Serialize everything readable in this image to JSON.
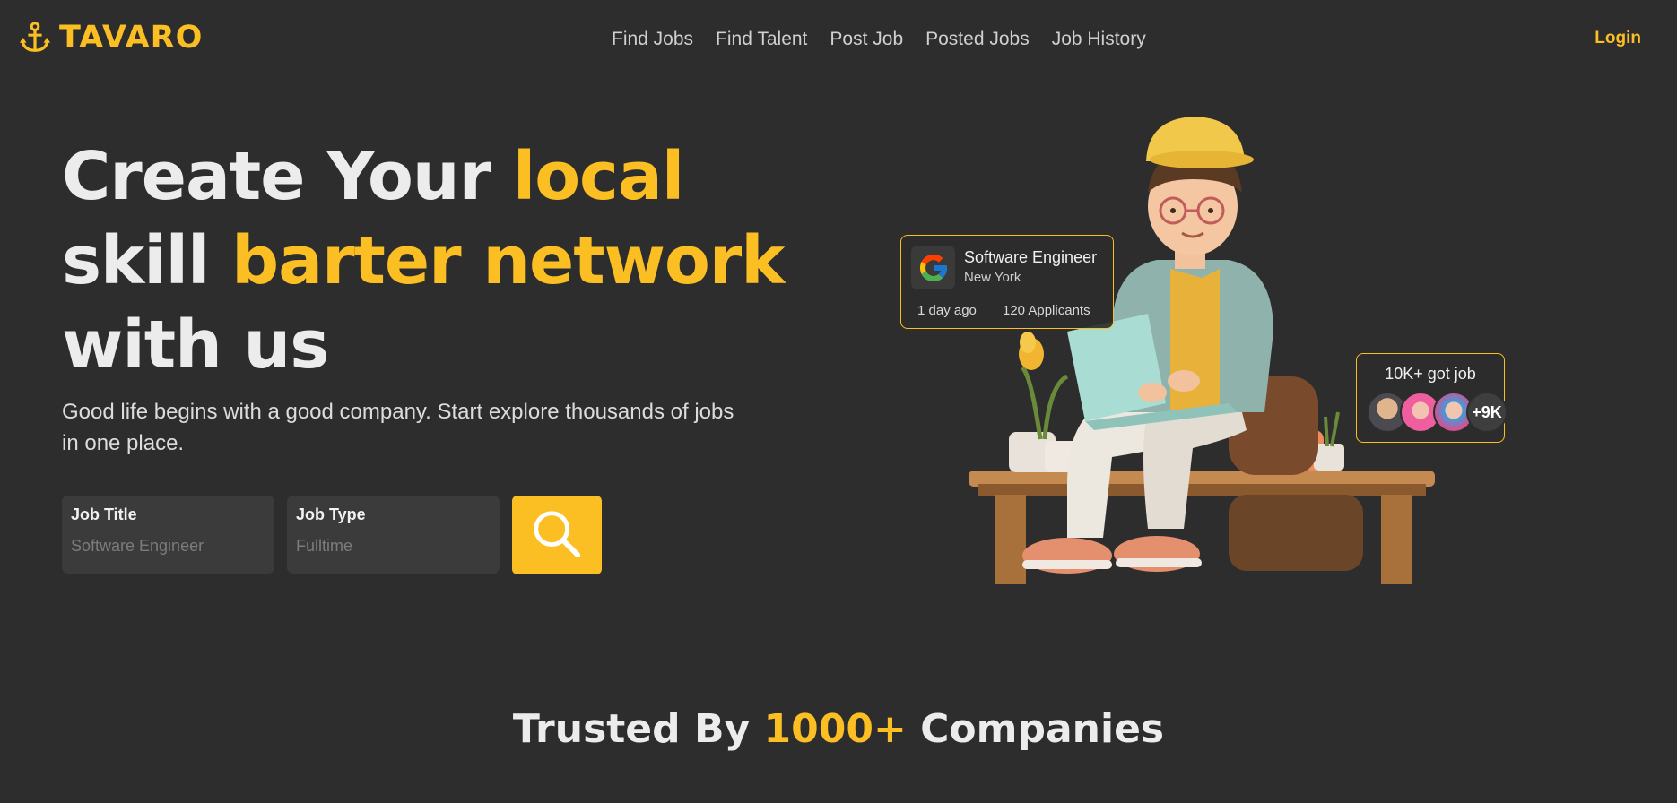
{
  "brand": {
    "name": "TAVARO",
    "icon": "anchor-icon",
    "accent_color": "#fbbf24"
  },
  "nav": {
    "links": [
      "Find Jobs",
      "Find Talent",
      "Post Job",
      "Posted Jobs",
      "Job History"
    ],
    "login_label": "Login"
  },
  "hero": {
    "title_1": "Create Your ",
    "title_1_accent": "local",
    "title_2": "skill ",
    "title_2_accent": "barter network",
    "title_3": "with us",
    "subtitle": "Good life begins with a good company. Start explore thousands of jobs in one place."
  },
  "search": {
    "job_title_label": "Job Title",
    "job_title_placeholder": "Software Engineer",
    "job_type_label": "Job Type",
    "job_type_placeholder": "Fulltime",
    "button_icon": "search-icon"
  },
  "job_card": {
    "company_icon": "google-logo-icon",
    "title": "Software Engineer",
    "location": "New York",
    "posted": "1 day ago",
    "applicants": "120 Applicants"
  },
  "got_job_card": {
    "text": "10K+ got job",
    "more": "+9K"
  },
  "trusted": {
    "prefix": "Trusted By ",
    "accent": "1000+",
    "suffix": " Companies"
  },
  "colors": {
    "background": "#2d2d2d",
    "accent": "#fbbf24",
    "field_bg": "#3b3b3b"
  }
}
